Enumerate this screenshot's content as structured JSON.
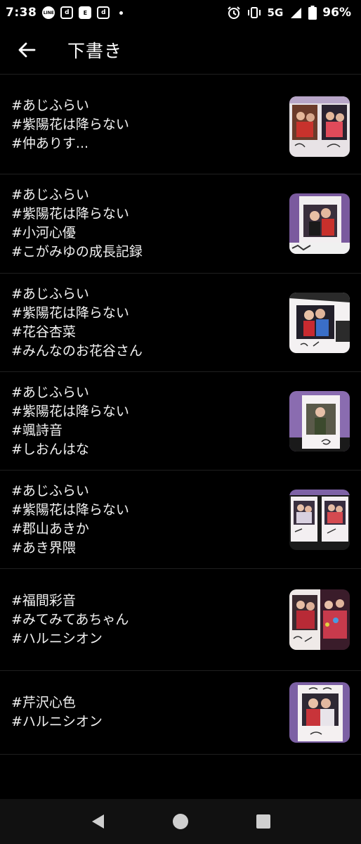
{
  "status": {
    "time": "7:38",
    "notif_line": "LINE",
    "notif_d1": "d",
    "notif_e": "E",
    "notif_d2": "d",
    "network": "5G",
    "battery": "96%"
  },
  "header": {
    "title": "下書き"
  },
  "drafts": [
    {
      "text": "#あじふらい\n#紫陽花は降らない\n#仲ありす..."
    },
    {
      "text": "#あじふらい\n#紫陽花は降らない\n#小河心優\n#こがみゆの成長記録"
    },
    {
      "text": "#あじふらい\n#紫陽花は降らない\n#花谷杏菜\n#みんなのお花谷さん"
    },
    {
      "text": "#あじふらい\n#紫陽花は降らない\n#颯詩音\n#しおんはな"
    },
    {
      "text": "#あじふらい\n#紫陽花は降らない\n#郡山あきか\n#あき界隈"
    },
    {
      "text": "#福間彩音\n#みてみてあちゃん\n#ハルニシオン"
    },
    {
      "text": "#芹沢心色\n#ハルニシオン"
    }
  ]
}
